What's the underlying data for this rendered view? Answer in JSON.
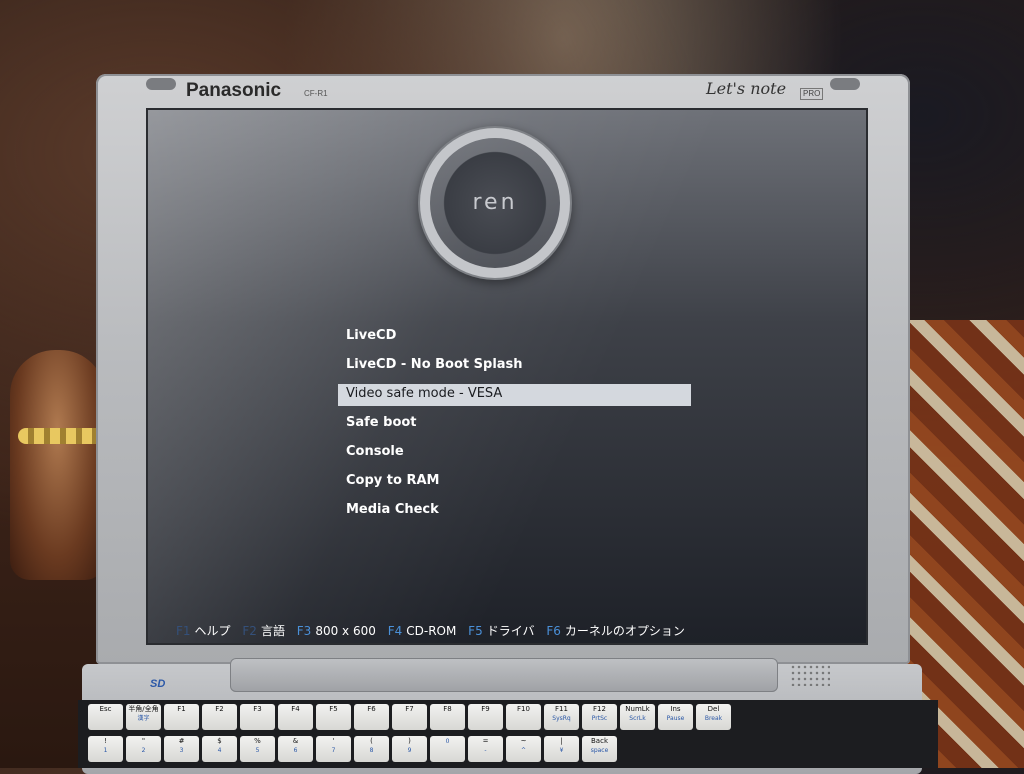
{
  "laptop": {
    "brand": "Panasonic",
    "model": "CF-R1",
    "series": "Let's note",
    "series_badge": "PRO",
    "media_logo": "SD"
  },
  "boot_screen": {
    "logo_text": "ren",
    "menu": [
      {
        "label": "LiveCD",
        "selected": false
      },
      {
        "label": "LiveCD - No Boot Splash",
        "selected": false
      },
      {
        "label": "Video safe mode - VESA",
        "selected": true
      },
      {
        "label": "Safe boot",
        "selected": false
      },
      {
        "label": "Console",
        "selected": false
      },
      {
        "label": "Copy to RAM",
        "selected": false
      },
      {
        "label": "Media Check",
        "selected": false
      }
    ],
    "function_keys": [
      {
        "key": "F1",
        "label": "ヘルプ"
      },
      {
        "key": "F2",
        "label": "言語"
      },
      {
        "key": "F3",
        "label": "800 x 600"
      },
      {
        "key": "F4",
        "label": "CD-ROM"
      },
      {
        "key": "F5",
        "label": "ドライバ"
      },
      {
        "key": "F6",
        "label": "カーネルのオプション"
      }
    ],
    "colors": {
      "selection_bg": "#d4d8de",
      "fkey_accent": "#4a90d8"
    }
  },
  "keyboard": {
    "row1": [
      {
        "label": "Esc",
        "sub": ""
      },
      {
        "label": "半角/全角",
        "sub": "漢字"
      },
      {
        "label": "F1",
        "sub": ""
      },
      {
        "label": "F2",
        "sub": ""
      },
      {
        "label": "F3",
        "sub": ""
      },
      {
        "label": "F4",
        "sub": ""
      },
      {
        "label": "F5",
        "sub": ""
      },
      {
        "label": "F6",
        "sub": ""
      },
      {
        "label": "F7",
        "sub": ""
      },
      {
        "label": "F8",
        "sub": ""
      },
      {
        "label": "F9",
        "sub": ""
      },
      {
        "label": "F10",
        "sub": ""
      },
      {
        "label": "F11",
        "sub": "SysRq"
      },
      {
        "label": "F12",
        "sub": "PrtSc"
      },
      {
        "label": "NumLk",
        "sub": "ScrLk"
      },
      {
        "label": "Ins",
        "sub": "Pause"
      },
      {
        "label": "Del",
        "sub": "Break"
      }
    ],
    "row2": [
      {
        "label": "!",
        "sub": "1"
      },
      {
        "label": "\"",
        "sub": "2"
      },
      {
        "label": "#",
        "sub": "3"
      },
      {
        "label": "$",
        "sub": "4"
      },
      {
        "label": "%",
        "sub": "5"
      },
      {
        "label": "&",
        "sub": "6"
      },
      {
        "label": "'",
        "sub": "7"
      },
      {
        "label": "(",
        "sub": "8"
      },
      {
        "label": ")",
        "sub": "9"
      },
      {
        "label": "",
        "sub": "0"
      },
      {
        "label": "=",
        "sub": "-"
      },
      {
        "label": "~",
        "sub": "^"
      },
      {
        "label": "|",
        "sub": "¥"
      },
      {
        "label": "Back",
        "sub": "space"
      }
    ]
  }
}
